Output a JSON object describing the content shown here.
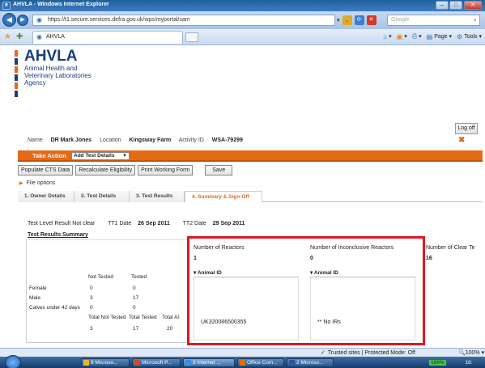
{
  "window": {
    "title": "AHVLA - Windows Internet Explorer",
    "minimize": "–",
    "maximize": "□",
    "close": "✕"
  },
  "address": {
    "url": "https://t1.secure.services.defra.gov.uk/wps/myportal/sam",
    "search_placeholder": "Google"
  },
  "tabbar": {
    "tab_label": "AHVLA",
    "commands": [
      "Page ▾",
      "Tools ▾"
    ]
  },
  "logo": {
    "title": "AHVLA",
    "lines": [
      "Animal Health and",
      "Veterinary Laboratories",
      "Agency"
    ]
  },
  "header": {
    "logoff": "Log off",
    "name_label": "Name",
    "name_value": "DR Mark Jones",
    "location_label": "Location",
    "location_value": "Kingsway Farm",
    "activity_label": "Activity ID",
    "activity_value": "WSA-79299",
    "close_glyph": "✖"
  },
  "action": {
    "label": "Take Action",
    "selected": "Add Test Details"
  },
  "buttons": {
    "populate": "Populate CTS Data",
    "recalc": "Recalculate Eligibility",
    "print": "Print Working Form",
    "save": "Save"
  },
  "file_options": "File options",
  "tabs": [
    {
      "label": "1. Owner Details",
      "active": false
    },
    {
      "label": "2. Test Details",
      "active": false
    },
    {
      "label": "3. Test Results",
      "active": false
    },
    {
      "label": "4. Summary & Sign-Off",
      "active": true
    }
  ],
  "summary": {
    "result_label": "Test Level Result",
    "result_value": "Not clear",
    "tt1_label": "TT1 Date",
    "tt1_value": "26 Sep 2011",
    "tt2_label": "TT2 Date",
    "tt2_value": "29 Sep 2011",
    "section_title": "Test Results Summary"
  },
  "left_table": {
    "col_not_tested": "Not Tested",
    "col_tested": "Tested",
    "rows": [
      {
        "label": "Female",
        "not_tested": "0",
        "tested": "0"
      },
      {
        "label": "Male",
        "not_tested": "3",
        "tested": "17"
      },
      {
        "label": "Calves under 42 days",
        "not_tested": "0",
        "tested": "0"
      }
    ],
    "totals_headers": [
      "Total Not Tested",
      "Total Tested",
      "Total Al"
    ],
    "totals_values": [
      "3",
      "17",
      "20"
    ]
  },
  "right_table": {
    "reactors_label": "Number of Reactors",
    "reactors_value": "1",
    "inconclusive_label": "Number of Inconclusive Reactors",
    "inconclusive_value": "0",
    "clear_label": "Number of Clear Te",
    "clear_value": "16",
    "col1_header": "Animal ID",
    "col2_header": "Animal ID",
    "col1_value": "UK320086500355",
    "col2_value": "** No IRs"
  },
  "status": {
    "trusted": "Trusted sites | Protected Mode: Off",
    "zoom": "100%"
  },
  "taskbar": {
    "buttons": [
      "8 Microso...",
      "Microsoft P...",
      "3 Internet ...",
      "Office Com...",
      "2 Microso..."
    ],
    "tray_pct": "100%",
    "time": "16:"
  },
  "colors": {
    "accent_orange": "#e46a16",
    "highlight_red": "#e0161f",
    "brand_blue": "#1a3e7a"
  }
}
